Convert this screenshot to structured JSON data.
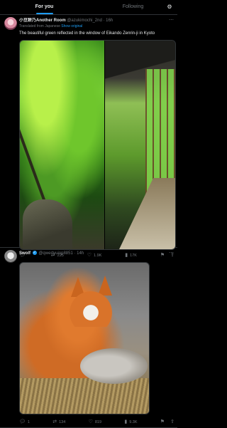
{
  "tabs": {
    "for_you": "For you",
    "following": "Following"
  },
  "posts": [
    {
      "author_name": "小豆餅乃Another Room",
      "handle": "@azukimochi_2nd · 16h",
      "translated_label": "Translated from Japanese",
      "show_original": "Show original",
      "text": "The beautiful green reflected in the window of Eikando Zenrin-ji in Kyoto",
      "stats": {
        "replies": "",
        "reposts": "225",
        "likes": "1.9K",
        "views": "17K"
      }
    },
    {
      "author_name": "Swolf",
      "handle": "@qwertyuiop8851 · 14h",
      "stats": {
        "replies": "1",
        "reposts": "134",
        "likes": "819",
        "views": "9.3K"
      }
    }
  ]
}
